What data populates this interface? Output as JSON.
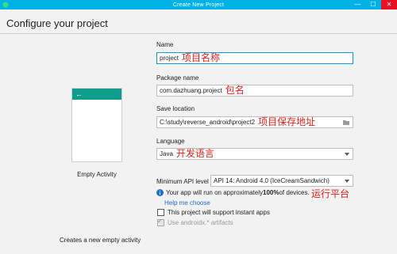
{
  "window": {
    "title": "Create New Project",
    "controls": [
      "—",
      "☐",
      "✕"
    ]
  },
  "page": {
    "heading": "Configure your project"
  },
  "template": {
    "name": "Empty Activity",
    "description": "Creates a new empty activity",
    "back_glyph": "←"
  },
  "form": {
    "name": {
      "label": "Name",
      "value": "project",
      "annotation": "项目名称"
    },
    "package": {
      "label": "Package name",
      "value": "com.dazhuang.project",
      "annotation": "包名"
    },
    "save_location": {
      "label": "Save location",
      "value": "C:\\study\\reverse_android\\project2",
      "annotation": "项目保存地址"
    },
    "language": {
      "label": "Language",
      "value": "Java",
      "annotation": "开发语言"
    },
    "min_api": {
      "label": "Minimum API level",
      "value": "API 14: Android 4.0 (IceCreamSandwich)"
    },
    "api_info": {
      "prefix": "Your app will run on approximately ",
      "percent": "100%",
      "suffix": " of devices.",
      "annotation": "运行平台"
    },
    "help_link": "Help me choose",
    "instant_apps": {
      "label": "This project will support instant apps",
      "checked": false
    },
    "androidx": {
      "label": "Use androidx.* artifacts",
      "checked": true,
      "disabled": true
    }
  },
  "colors": {
    "titlebar": "#00b2e6",
    "template_appbar": "#109e8c",
    "annotation": "#e0201a",
    "link": "#1f6fd0"
  }
}
